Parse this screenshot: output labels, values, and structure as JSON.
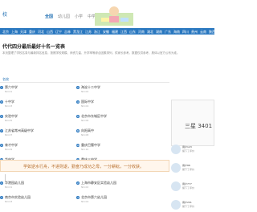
{
  "header": {
    "logo_text": "校",
    "nav": [
      "全国",
      "幼儿园",
      "小学",
      "中学",
      "大学"
    ]
  },
  "regions": [
    "北京",
    "上海",
    "天津",
    "重庆",
    "河北",
    "山西",
    "辽宁",
    "吉林",
    "黑龙江",
    "江苏",
    "浙江",
    "安徽",
    "福建",
    "江西",
    "山东",
    "河南",
    "湖北",
    "湖南",
    "广东",
    "海南",
    "四川",
    "贵州",
    "云南",
    "陕西",
    "甘肃",
    "青海",
    "内蒙古",
    "广西",
    "西藏",
    "宁夏",
    "新疆",
    "港澳"
  ],
  "page": {
    "title": "代代四分最后最好十名一览表",
    "intro": "本页整理了学校名录与最新排名信息，按照学校规模、师资力量、升学率等综合因素排列，供家长参考。数据仅供参考，具体以官方公布为准。"
  },
  "rank_section": {
    "heading": "名校",
    "items": [
      {
        "num": "1",
        "name": "第六中学",
        "meta": "NO.01"
      },
      {
        "num": "2",
        "name": "海淀十二中学",
        "meta": "NO.02"
      },
      {
        "num": "3",
        "name": "十中学",
        "meta": "NO.03"
      },
      {
        "num": "4",
        "name": "国际中学",
        "meta": "NO.04"
      },
      {
        "num": "5",
        "name": "实验中学",
        "meta": "NO.05"
      },
      {
        "num": "6",
        "name": "北京市东城区中学",
        "meta": "NO.06"
      },
      {
        "num": "7",
        "name": "江苏省常州高级中学",
        "meta": "NO.07"
      },
      {
        "num": "8",
        "name": "向阳高中",
        "meta": "NO.08"
      },
      {
        "num": "9",
        "name": "育才中学",
        "meta": "NO.09"
      },
      {
        "num": "10",
        "name": "重庆巴蜀中学",
        "meta": "NO.10"
      },
      {
        "num": "11",
        "name": "华中学",
        "meta": "NO.11"
      },
      {
        "num": "12",
        "name": "重庆三中学",
        "meta": "NO.12"
      }
    ]
  },
  "banner": {
    "text": "学如逆水行舟，不进则退，勤奋乃成功之母，一分耕耘，一分收获。"
  },
  "kids_section": {
    "items": [
      {
        "num": "1",
        "name": "华港园幼儿园",
        "meta": "NO.01"
      },
      {
        "num": "2",
        "name": "上海市静安区实验幼儿园",
        "meta": "NO.02"
      },
      {
        "num": "3",
        "name": "南京市实验幼儿园",
        "meta": "NO.03"
      },
      {
        "num": "4",
        "name": "北京市第六幼儿园",
        "meta": "NO.04"
      }
    ]
  },
  "right_panel": {
    "calendar": "三星 3401",
    "users": [
      {
        "name": "用户123",
        "note": "留下了评价"
      },
      {
        "name": "用户88",
        "note": "留下了评价"
      },
      {
        "name": "用户777",
        "note": "留下了评价"
      },
      {
        "name": "用户201",
        "note": "留下了评价"
      }
    ]
  }
}
